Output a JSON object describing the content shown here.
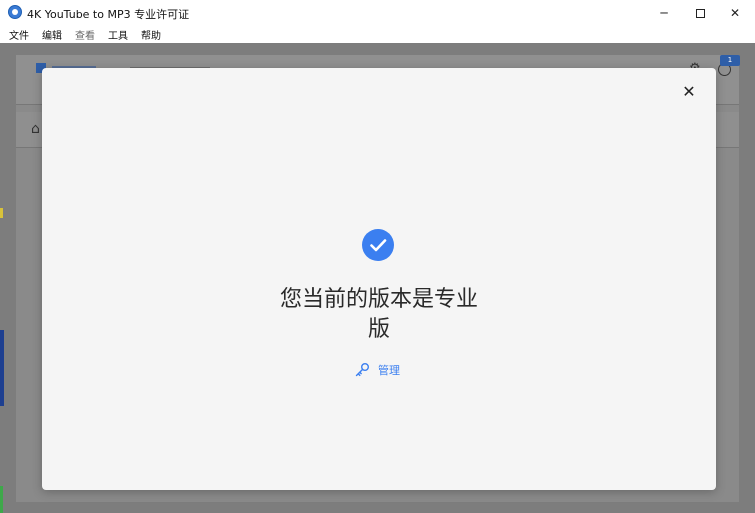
{
  "window": {
    "title": "4K YouTube to MP3 专业许可证",
    "minimize_glyph": "─",
    "close_glyph": "✕"
  },
  "menu": {
    "items": [
      "文件",
      "编辑",
      "查看",
      "工具",
      "帮助"
    ]
  },
  "background": {
    "badge_text": "1",
    "home_icon": "⌂",
    "settings_icon": "⚙"
  },
  "dialog": {
    "close_glyph": "✕",
    "icon": "check-circle-icon",
    "headline_line1": "您当前的版本是专业",
    "headline_line2": "版",
    "manage_label": "管理",
    "manage_icon": "key-icon",
    "accent_color": "#3b7ff0"
  }
}
